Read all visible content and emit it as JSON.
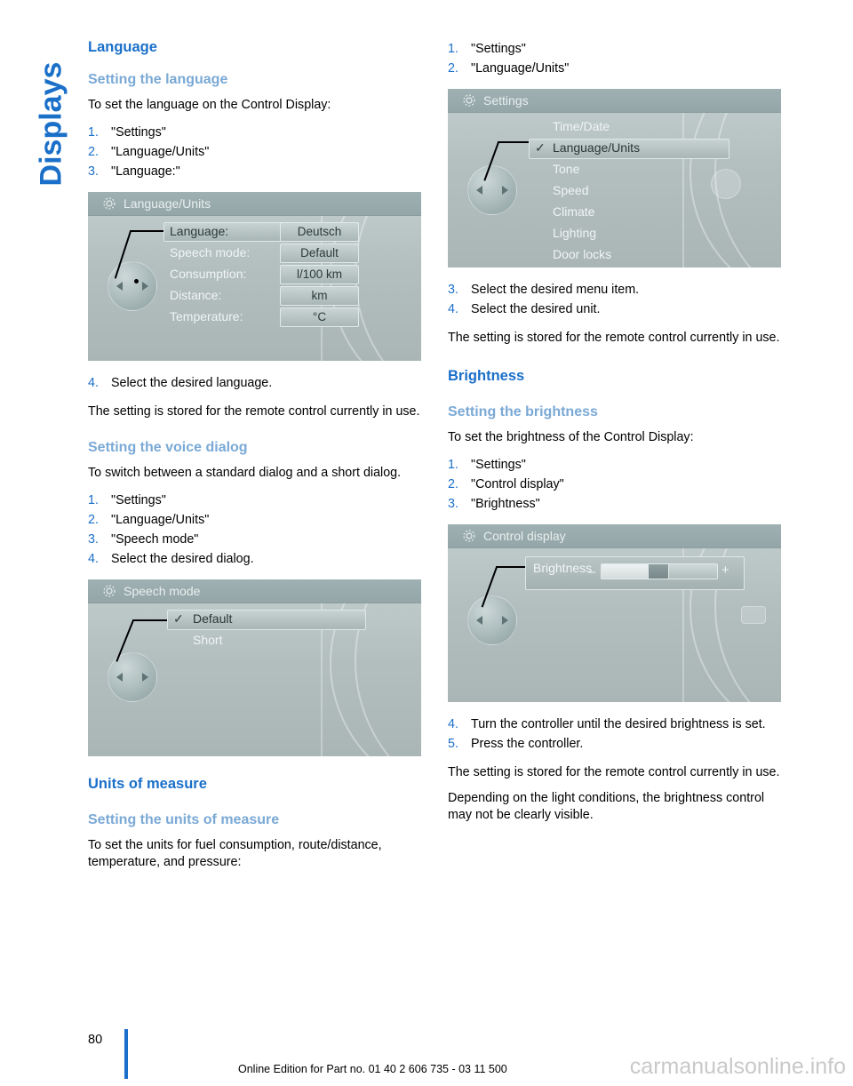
{
  "side_tab": {
    "label": "Displays"
  },
  "left_column": {
    "title": "Language",
    "section1": {
      "heading": "Setting the language",
      "intro": "To set the language on the Control Display:",
      "steps": [
        "\"Settings\"",
        "\"Language/Units\"",
        "\"Language:\""
      ],
      "after_steps": [
        "Select the desired language."
      ],
      "after_text": "The setting is stored for the remote control currently in use."
    },
    "section2": {
      "heading": "Setting the voice dialog",
      "intro": "To switch between a standard dialog and a short dialog.",
      "steps": [
        "\"Settings\"",
        "\"Language/Units\"",
        "\"Speech mode\"",
        "Select the desired dialog."
      ]
    },
    "section3": {
      "heading": "Units of measure",
      "subheading": "Setting the units of measure",
      "intro": "To set the units for fuel consumption, route/distance, temperature, and pressure:"
    },
    "figure_language_units": {
      "title": "Language/Units",
      "rows": [
        {
          "label": "Language:",
          "value": "Deutsch"
        },
        {
          "label": "Speech mode:",
          "value": "Default"
        },
        {
          "label": "Consumption:",
          "value": "l/100 km"
        },
        {
          "label": "Distance:",
          "value": "km"
        },
        {
          "label": "Temperature:",
          "value": "°C"
        }
      ]
    },
    "figure_speech_mode": {
      "title": "Speech mode",
      "rows": [
        "Default",
        "Short"
      ],
      "checked": "Default"
    }
  },
  "right_column": {
    "top_steps": [
      "\"Settings\"",
      "\"Language/Units\""
    ],
    "figure_settings": {
      "title": "Settings",
      "rows": [
        "Time/Date",
        "Language/Units",
        "Tone",
        "Speed",
        "Climate",
        "Lighting",
        "Door locks"
      ],
      "checked": "Language/Units"
    },
    "steps_after_fig": [
      "Select the desired menu item.",
      "Select the desired unit."
    ],
    "text_after": "The setting is stored for the remote control currently in use.",
    "section_brightness": {
      "title": "Brightness",
      "heading": "Setting the brightness",
      "intro": "To set the brightness of the Control Display:",
      "steps": [
        "\"Settings\"",
        "\"Control display\"",
        "\"Brightness\""
      ]
    },
    "figure_control_display": {
      "title": "Control display",
      "label": "Brightness",
      "minus": "–",
      "plus": "+"
    },
    "steps_final": [
      "Turn the controller until the desired brightness is set.",
      "Press the controller."
    ],
    "text_final1": "The setting is stored for the remote control currently in use.",
    "text_final2": "Depending on the light conditions, the brightness control may not be clearly visible."
  },
  "footer": {
    "page_number": "80",
    "text": "Online Edition for Part no. 01 40 2 606 735 - 03 11 500",
    "watermark": "carmanualsonline.info"
  },
  "colors": {
    "accent": "#1a6fc9",
    "subhead": "#7aa9d6"
  }
}
